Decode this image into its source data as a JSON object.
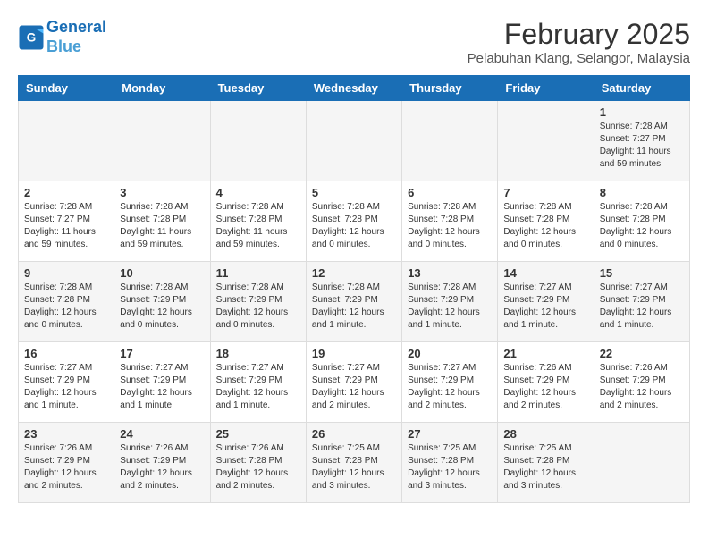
{
  "header": {
    "logo_line1": "General",
    "logo_line2": "Blue",
    "month_title": "February 2025",
    "subtitle": "Pelabuhan Klang, Selangor, Malaysia"
  },
  "days_of_week": [
    "Sunday",
    "Monday",
    "Tuesday",
    "Wednesday",
    "Thursday",
    "Friday",
    "Saturday"
  ],
  "weeks": [
    {
      "row_class": "alt-row",
      "cells": [
        {
          "day": "",
          "info": ""
        },
        {
          "day": "",
          "info": ""
        },
        {
          "day": "",
          "info": ""
        },
        {
          "day": "",
          "info": ""
        },
        {
          "day": "",
          "info": ""
        },
        {
          "day": "",
          "info": ""
        },
        {
          "day": "1",
          "info": "Sunrise: 7:28 AM\nSunset: 7:27 PM\nDaylight: 11 hours\nand 59 minutes."
        }
      ]
    },
    {
      "row_class": "",
      "cells": [
        {
          "day": "2",
          "info": "Sunrise: 7:28 AM\nSunset: 7:27 PM\nDaylight: 11 hours\nand 59 minutes."
        },
        {
          "day": "3",
          "info": "Sunrise: 7:28 AM\nSunset: 7:28 PM\nDaylight: 11 hours\nand 59 minutes."
        },
        {
          "day": "4",
          "info": "Sunrise: 7:28 AM\nSunset: 7:28 PM\nDaylight: 11 hours\nand 59 minutes."
        },
        {
          "day": "5",
          "info": "Sunrise: 7:28 AM\nSunset: 7:28 PM\nDaylight: 12 hours\nand 0 minutes."
        },
        {
          "day": "6",
          "info": "Sunrise: 7:28 AM\nSunset: 7:28 PM\nDaylight: 12 hours\nand 0 minutes."
        },
        {
          "day": "7",
          "info": "Sunrise: 7:28 AM\nSunset: 7:28 PM\nDaylight: 12 hours\nand 0 minutes."
        },
        {
          "day": "8",
          "info": "Sunrise: 7:28 AM\nSunset: 7:28 PM\nDaylight: 12 hours\nand 0 minutes."
        }
      ]
    },
    {
      "row_class": "alt-row",
      "cells": [
        {
          "day": "9",
          "info": "Sunrise: 7:28 AM\nSunset: 7:28 PM\nDaylight: 12 hours\nand 0 minutes."
        },
        {
          "day": "10",
          "info": "Sunrise: 7:28 AM\nSunset: 7:29 PM\nDaylight: 12 hours\nand 0 minutes."
        },
        {
          "day": "11",
          "info": "Sunrise: 7:28 AM\nSunset: 7:29 PM\nDaylight: 12 hours\nand 0 minutes."
        },
        {
          "day": "12",
          "info": "Sunrise: 7:28 AM\nSunset: 7:29 PM\nDaylight: 12 hours\nand 1 minute."
        },
        {
          "day": "13",
          "info": "Sunrise: 7:28 AM\nSunset: 7:29 PM\nDaylight: 12 hours\nand 1 minute."
        },
        {
          "day": "14",
          "info": "Sunrise: 7:27 AM\nSunset: 7:29 PM\nDaylight: 12 hours\nand 1 minute."
        },
        {
          "day": "15",
          "info": "Sunrise: 7:27 AM\nSunset: 7:29 PM\nDaylight: 12 hours\nand 1 minute."
        }
      ]
    },
    {
      "row_class": "",
      "cells": [
        {
          "day": "16",
          "info": "Sunrise: 7:27 AM\nSunset: 7:29 PM\nDaylight: 12 hours\nand 1 minute."
        },
        {
          "day": "17",
          "info": "Sunrise: 7:27 AM\nSunset: 7:29 PM\nDaylight: 12 hours\nand 1 minute."
        },
        {
          "day": "18",
          "info": "Sunrise: 7:27 AM\nSunset: 7:29 PM\nDaylight: 12 hours\nand 1 minute."
        },
        {
          "day": "19",
          "info": "Sunrise: 7:27 AM\nSunset: 7:29 PM\nDaylight: 12 hours\nand 2 minutes."
        },
        {
          "day": "20",
          "info": "Sunrise: 7:27 AM\nSunset: 7:29 PM\nDaylight: 12 hours\nand 2 minutes."
        },
        {
          "day": "21",
          "info": "Sunrise: 7:26 AM\nSunset: 7:29 PM\nDaylight: 12 hours\nand 2 minutes."
        },
        {
          "day": "22",
          "info": "Sunrise: 7:26 AM\nSunset: 7:29 PM\nDaylight: 12 hours\nand 2 minutes."
        }
      ]
    },
    {
      "row_class": "alt-row",
      "cells": [
        {
          "day": "23",
          "info": "Sunrise: 7:26 AM\nSunset: 7:29 PM\nDaylight: 12 hours\nand 2 minutes."
        },
        {
          "day": "24",
          "info": "Sunrise: 7:26 AM\nSunset: 7:29 PM\nDaylight: 12 hours\nand 2 minutes."
        },
        {
          "day": "25",
          "info": "Sunrise: 7:26 AM\nSunset: 7:28 PM\nDaylight: 12 hours\nand 2 minutes."
        },
        {
          "day": "26",
          "info": "Sunrise: 7:25 AM\nSunset: 7:28 PM\nDaylight: 12 hours\nand 3 minutes."
        },
        {
          "day": "27",
          "info": "Sunrise: 7:25 AM\nSunset: 7:28 PM\nDaylight: 12 hours\nand 3 minutes."
        },
        {
          "day": "28",
          "info": "Sunrise: 7:25 AM\nSunset: 7:28 PM\nDaylight: 12 hours\nand 3 minutes."
        },
        {
          "day": "",
          "info": ""
        }
      ]
    }
  ]
}
